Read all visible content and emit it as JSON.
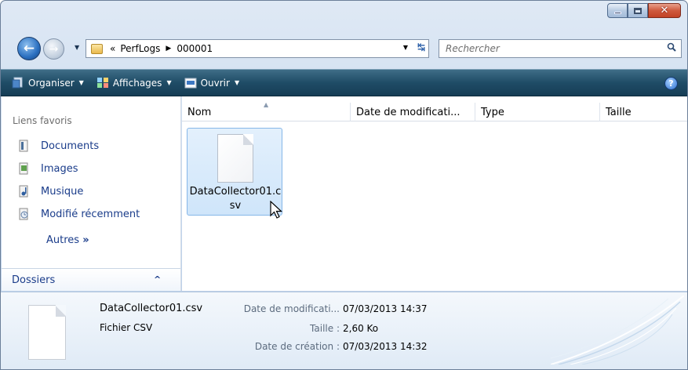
{
  "window": {
    "caption_buttons": [
      "minimize",
      "maximize",
      "close"
    ]
  },
  "nav": {
    "address_prefix": "«",
    "breadcrumbs": [
      "PerfLogs",
      "000001"
    ],
    "search_placeholder": "Rechercher"
  },
  "toolbar": {
    "organize": "Organiser",
    "views": "Affichages",
    "open": "Ouvrir"
  },
  "navpane": {
    "favorites_title": "Liens favoris",
    "favorites": [
      {
        "label": "Documents",
        "icon": "documents-icon"
      },
      {
        "label": "Images",
        "icon": "images-icon"
      },
      {
        "label": "Musique",
        "icon": "music-icon"
      },
      {
        "label": "Modifié récemment",
        "icon": "recent-icon"
      }
    ],
    "more": "Autres",
    "more_glyph": "»",
    "folders": "Dossiers"
  },
  "columns": [
    "Nom",
    "Date de modificati...",
    "Type",
    "Taille"
  ],
  "files": [
    {
      "name": "DataCollector01.csv",
      "selected": true
    }
  ],
  "details": {
    "file_name": "DataCollector01.csv",
    "file_type": "Fichier CSV",
    "fields": [
      {
        "label": "Date de modificati...",
        "value": "07/03/2013 14:37"
      },
      {
        "label": "Taille :",
        "value": "2,60 Ko"
      },
      {
        "label": "Date de création :",
        "value": "07/03/2013 14:32"
      }
    ]
  },
  "colors": {
    "toolbar": "#1f4c66",
    "link": "#1a3c8a",
    "selection": "#cfe5fa",
    "close": "#c24225"
  }
}
